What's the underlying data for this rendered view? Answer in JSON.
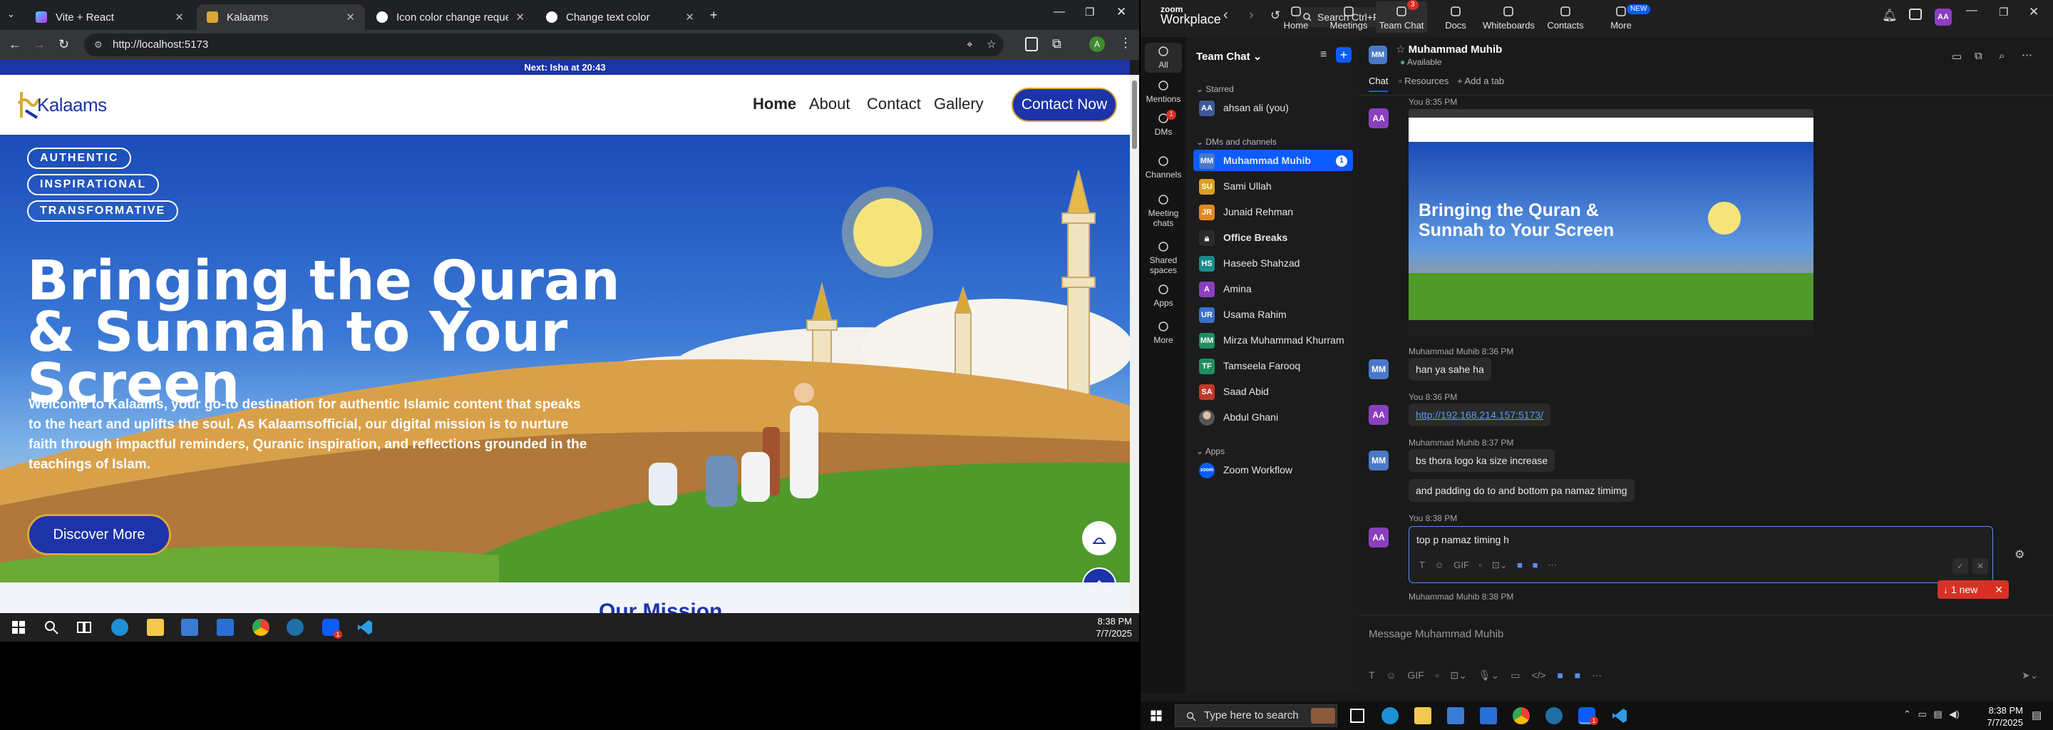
{
  "left_monitor": {
    "browser": {
      "tabs": [
        {
          "title": "Vite + React",
          "active": false
        },
        {
          "title": "Kalaams",
          "active": true
        },
        {
          "title": "Icon color change request",
          "active": false
        },
        {
          "title": "Change text color",
          "active": false
        }
      ],
      "url": "http://localhost:5173"
    },
    "website": {
      "announcement": "Next: Isha at 20:43",
      "logo_text": "Kalaams",
      "nav": [
        "Home",
        "About",
        "Contact",
        "Gallery"
      ],
      "contact_button": "Contact Now",
      "pills": [
        "AUTHENTIC",
        "INSPIRATIONAL",
        "TRANSFORMATIVE"
      ],
      "hero_title": "Bringing the Quran & Sunnah to Your Screen",
      "hero_description": "Welcome to Kalaams, your go-to destination for authentic Islamic content that speaks to the heart and uplifts the soul. As Kalaamsofficial, our digital mission is to nurture faith through impactful reminders, Quranic inspiration, and reflections grounded in the teachings of Islam.",
      "discover_button": "Discover More",
      "next_section_title": "Our Mission"
    },
    "taskbar": {
      "time": "8:38 PM",
      "date": "7/7/2025",
      "zoom_badge": "1"
    }
  },
  "zoom": {
    "logo_top": "zoom",
    "logo_bottom": "Workplace",
    "search": {
      "label": "Search",
      "shortcut": "Ctrl+F"
    },
    "top_tabs": [
      {
        "label": "Home",
        "icon": "home-icon",
        "badge": ""
      },
      {
        "label": "Meetings",
        "icon": "video-icon",
        "badge": ""
      },
      {
        "label": "Team Chat",
        "icon": "chat-icon",
        "badge": "3"
      },
      {
        "label": "Docs",
        "icon": "doc-icon",
        "badge": ""
      },
      {
        "label": "Whiteboards",
        "icon": "whiteboard-icon",
        "badge": ""
      },
      {
        "label": "Contacts",
        "icon": "contacts-icon",
        "badge": ""
      },
      {
        "label": "More",
        "icon": "more-icon",
        "badge": "NEW"
      }
    ],
    "avatar_initials": "AA",
    "rail": [
      {
        "label": "All",
        "icon": "chat-bubbles-icon",
        "badge": ""
      },
      {
        "label": "Mentions",
        "icon": "at-icon",
        "badge": ""
      },
      {
        "label": "DMs",
        "icon": "people-icon",
        "badge": "1"
      },
      {
        "label": "Channels",
        "icon": "hash-icon",
        "badge": ""
      },
      {
        "label": "Meeting chats",
        "icon": "calendar-icon",
        "badge": ""
      },
      {
        "label": "Shared spaces",
        "icon": "share-icon",
        "badge": ""
      },
      {
        "label": "Apps",
        "icon": "apps-icon",
        "badge": ""
      },
      {
        "label": "More",
        "icon": "ellipsis-icon",
        "badge": ""
      }
    ],
    "list_title": "Team Chat",
    "sections": {
      "starred": "Starred",
      "dms": "DMs and channels",
      "apps": "Apps"
    },
    "starred": [
      {
        "name": "ahsan ali (you)",
        "initials": "AA",
        "color": "#3c5a9a"
      }
    ],
    "contacts": [
      {
        "name": "Muhammad Muhib",
        "initials": "MM",
        "color": "#4a78c8",
        "active": true,
        "badge": "1"
      },
      {
        "name": "Sami Ullah",
        "initials": "SU",
        "color": "#d9a21e",
        "active": false,
        "badge": ""
      },
      {
        "name": "Junaid Rehman",
        "initials": "JR",
        "color": "#e08a1e",
        "active": false,
        "badge": ""
      },
      {
        "name": "Office Breaks",
        "initials": "",
        "color": "#2b2b2b",
        "active": false,
        "badge": "",
        "locked": true
      },
      {
        "name": "Haseeb Shahzad",
        "initials": "HS",
        "color": "#1c8a8a",
        "active": false,
        "badge": ""
      },
      {
        "name": "Amina",
        "initials": "A",
        "color": "#8b3fbf",
        "active": false,
        "badge": ""
      },
      {
        "name": "Usama Rahim",
        "initials": "UR",
        "color": "#3a6fc9",
        "active": false,
        "badge": ""
      },
      {
        "name": "Mirza Muhammad Khurram",
        "initials": "MM",
        "color": "#1f8f5f",
        "active": false,
        "badge": ""
      },
      {
        "name": "Tamseela Farooq",
        "initials": "TF",
        "color": "#1f8f5f",
        "active": false,
        "badge": ""
      },
      {
        "name": "Saad Abid",
        "initials": "SA",
        "color": "#c0392b",
        "active": false,
        "badge": ""
      },
      {
        "name": "Abdul Ghani",
        "initials": "",
        "color": "#666666",
        "active": false,
        "badge": "",
        "photo": true
      }
    ],
    "apps": [
      {
        "name": "Zoom Workflow",
        "initials": "zoom",
        "color": "#0b5cff"
      }
    ],
    "chat": {
      "contact_name": "Muhammad Muhib",
      "contact_initials": "MM",
      "status": "Available",
      "tabs": [
        "Chat",
        "Resources",
        "Add a tab"
      ],
      "messages": [
        {
          "meta": "You 8:35 PM",
          "avatar": "AA",
          "type": "image"
        },
        {
          "meta": "Muhammad Muhib 8:36 PM",
          "avatar": "MM",
          "text": "han ya sahe ha"
        },
        {
          "meta": "You 8:36 PM",
          "avatar": "AA",
          "text": "http://192.168.214.157:5173/",
          "link": true
        },
        {
          "meta": "Muhammad Muhib 8:37 PM",
          "avatar": "MM",
          "text": "bs thora logo ka size increase"
        },
        {
          "meta": "",
          "avatar": "",
          "text": "and padding do to and bottom pa namaz timimg"
        },
        {
          "meta": "You 8:38 PM",
          "avatar": "AA",
          "text": "top p namaz timing h",
          "editing": true
        },
        {
          "meta": "Muhammad Muhib 8:38 PM",
          "avatar": "",
          "text": ""
        }
      ],
      "new_badge": "1 new",
      "composer_placeholder": "Message Muhammad Muhib",
      "format_gif": "GIF"
    },
    "taskbar": {
      "search_placeholder": "Type here to search",
      "time": "8:38 PM",
      "date": "7/7/2025",
      "zoom_badge": "1"
    }
  }
}
